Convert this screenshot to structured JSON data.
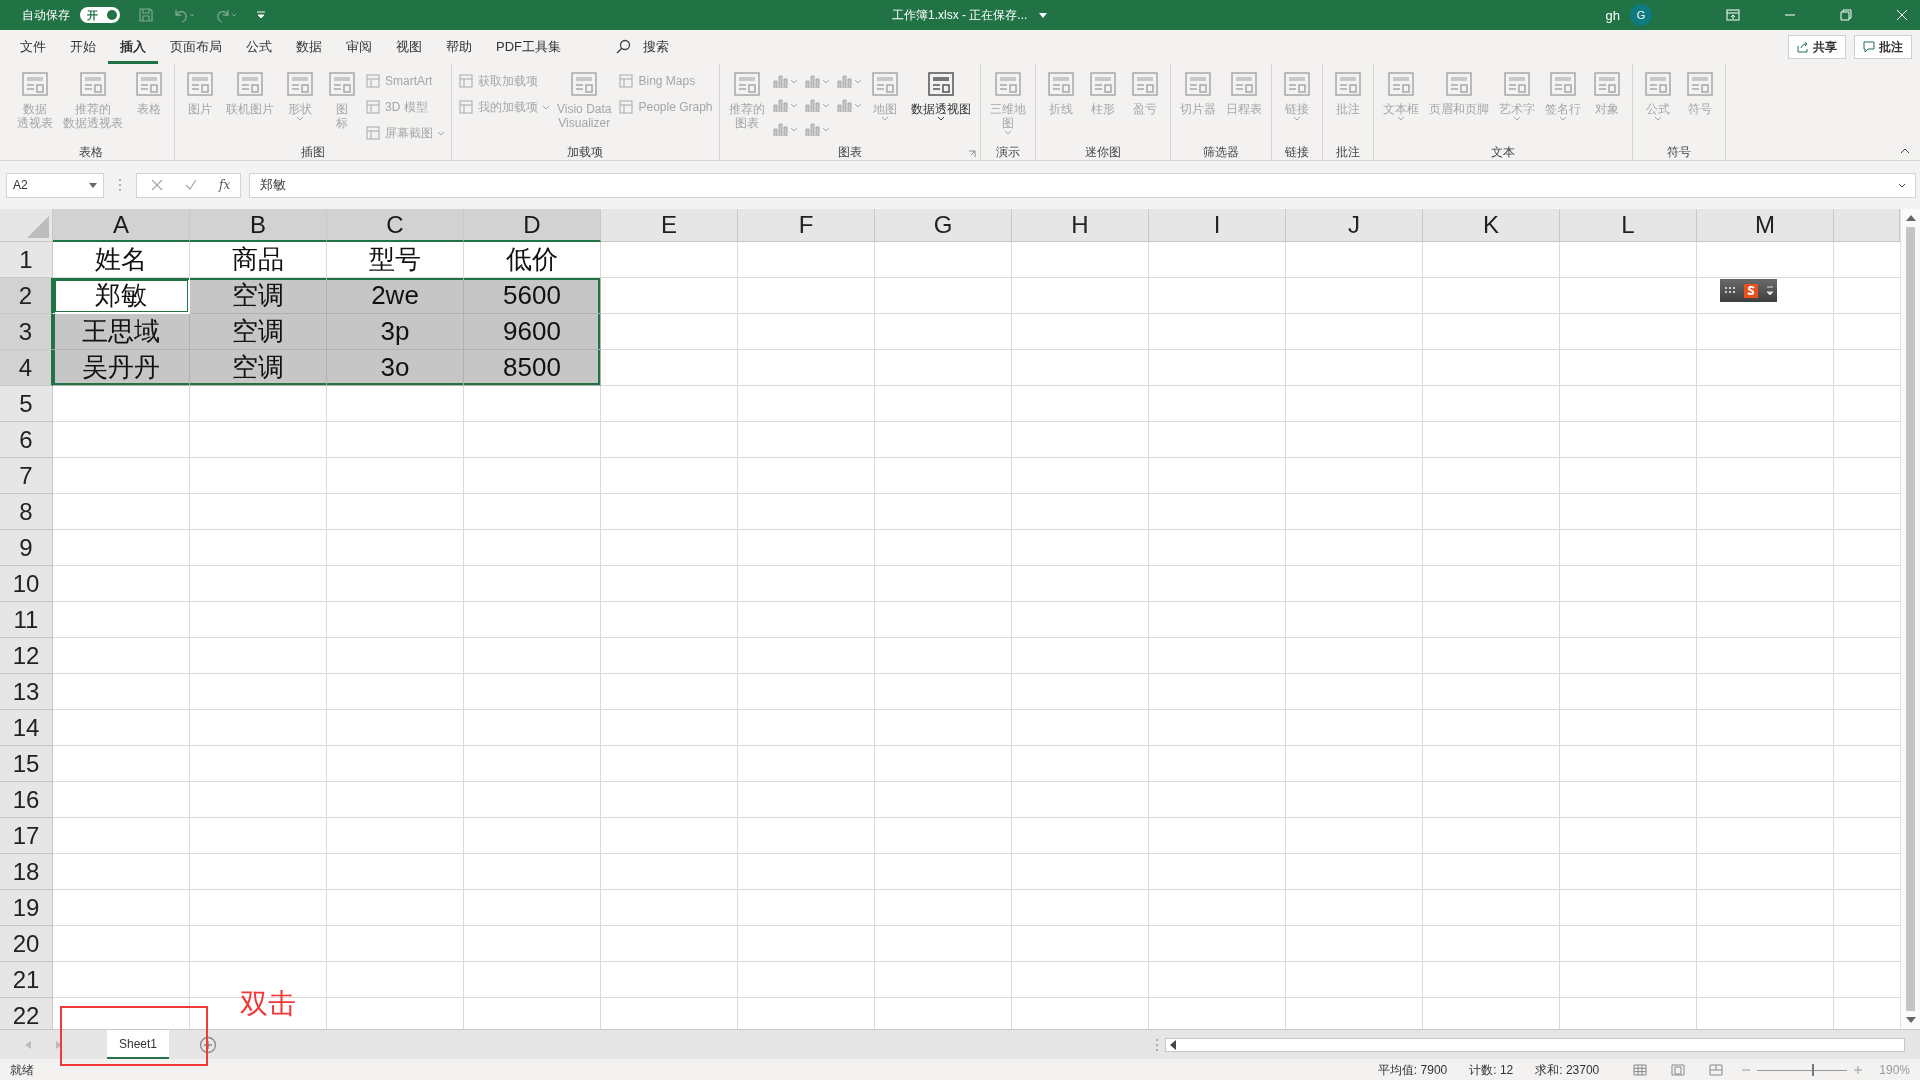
{
  "title_bar": {
    "autosave_label": "自动保存",
    "autosave": {
      "label": "开",
      "on": true
    },
    "document_title": "工作簿1.xlsx  -  正在保存...",
    "user": "gh",
    "avatar": "G"
  },
  "menu_tabs": [
    {
      "label": "文件",
      "selected": false
    },
    {
      "label": "开始",
      "selected": false
    },
    {
      "label": "插入",
      "selected": true
    },
    {
      "label": "页面布局",
      "selected": false
    },
    {
      "label": "公式",
      "selected": false
    },
    {
      "label": "数据",
      "selected": false
    },
    {
      "label": "审阅",
      "selected": false
    },
    {
      "label": "视图",
      "selected": false
    },
    {
      "label": "帮助",
      "selected": false
    },
    {
      "label": "PDF工具集",
      "selected": false
    }
  ],
  "search": {
    "label": "搜索"
  },
  "actions": [
    {
      "kind": "share",
      "label": "共享"
    },
    {
      "kind": "comment",
      "label": "批注"
    }
  ],
  "ribbon": [
    {
      "label": "表格",
      "launcher": false,
      "items": [
        {
          "kind": "large",
          "lines": [
            "数据",
            "透视表"
          ],
          "disabled": true,
          "dropdown": false
        },
        {
          "kind": "large",
          "lines": [
            "推荐的",
            "数据透视表"
          ],
          "disabled": true,
          "dropdown": false
        },
        {
          "kind": "large",
          "lines": [
            "表格"
          ],
          "disabled": true,
          "dropdown": false
        }
      ]
    },
    {
      "label": "插图",
      "launcher": false,
      "items": [
        {
          "kind": "large",
          "lines": [
            "图片"
          ],
          "disabled": true,
          "dropdown": false
        },
        {
          "kind": "large",
          "lines": [
            "联机图片"
          ],
          "disabled": true,
          "dropdown": false
        },
        {
          "kind": "large",
          "lines": [
            "形状"
          ],
          "disabled": true,
          "dropdown": true
        },
        {
          "kind": "large",
          "lines": [
            "图",
            "标"
          ],
          "disabled": true,
          "dropdown": false
        },
        {
          "kind": "stack",
          "items": [
            {
              "label": "SmartArt",
              "disabled": true,
              "dropdown": false
            },
            {
              "label": "3D 模型",
              "disabled": true,
              "dropdown": false
            },
            {
              "label": "屏幕截图",
              "disabled": true,
              "dropdown": true
            }
          ]
        }
      ]
    },
    {
      "label": "加载项",
      "launcher": false,
      "items": [
        {
          "kind": "stack",
          "items": [
            {
              "label": "获取加载项",
              "disabled": true,
              "dropdown": false
            },
            {
              "label": "我的加载项",
              "disabled": true,
              "dropdown": true
            }
          ]
        },
        {
          "kind": "large",
          "lines": [
            "Visio Data",
            "Visualizer"
          ],
          "disabled": true,
          "dropdown": false
        },
        {
          "kind": "stack",
          "items": [
            {
              "label": "Bing Maps",
              "disabled": true,
              "dropdown": false
            },
            {
              "label": "People Graph",
              "disabled": true,
              "dropdown": false
            }
          ]
        }
      ]
    },
    {
      "label": "图表",
      "launcher": true,
      "items": [
        {
          "kind": "large",
          "lines": [
            "推荐的",
            "图表"
          ],
          "disabled": true,
          "dropdown": false
        },
        {
          "kind": "icongrid",
          "items": [
            {
              "disabled": true,
              "dropdown": true
            },
            {
              "disabled": true,
              "dropdown": true
            },
            {
              "disabled": true,
              "dropdown": true
            },
            {
              "disabled": true,
              "dropdown": true
            },
            {
              "disabled": true,
              "dropdown": true
            },
            {
              "disabled": true,
              "dropdown": true
            },
            {
              "disabled": true,
              "dropdown": true
            },
            {
              "disabled": true,
              "dropdown": true
            }
          ]
        },
        {
          "kind": "large",
          "lines": [
            "地图"
          ],
          "disabled": true,
          "dropdown": true
        },
        {
          "kind": "large",
          "lines": [
            "数据透视图"
          ],
          "disabled": false,
          "dropdown": true
        }
      ]
    },
    {
      "label": "演示",
      "launcher": false,
      "items": [
        {
          "kind": "large",
          "lines": [
            "三维地",
            "图"
          ],
          "disabled": true,
          "dropdown": true
        }
      ]
    },
    {
      "label": "迷你图",
      "launcher": false,
      "items": [
        {
          "kind": "large",
          "lines": [
            "折线"
          ],
          "disabled": true,
          "dropdown": false
        },
        {
          "kind": "large",
          "lines": [
            "柱形"
          ],
          "disabled": true,
          "dropdown": false
        },
        {
          "kind": "large",
          "lines": [
            "盈亏"
          ],
          "disabled": true,
          "dropdown": false
        }
      ]
    },
    {
      "label": "筛选器",
      "launcher": false,
      "items": [
        {
          "kind": "large",
          "lines": [
            "切片器"
          ],
          "disabled": true,
          "dropdown": false
        },
        {
          "kind": "large",
          "lines": [
            "日程表"
          ],
          "disabled": true,
          "dropdown": false
        }
      ]
    },
    {
      "label": "链接",
      "launcher": false,
      "items": [
        {
          "kind": "large",
          "lines": [
            "链接"
          ],
          "disabled": true,
          "dropdown": true
        }
      ]
    },
    {
      "label": "批注",
      "launcher": false,
      "items": [
        {
          "kind": "large",
          "lines": [
            "批注"
          ],
          "disabled": true,
          "dropdown": false
        }
      ]
    },
    {
      "label": "文本",
      "launcher": false,
      "items": [
        {
          "kind": "large",
          "lines": [
            "文本框"
          ],
          "disabled": true,
          "dropdown": true
        },
        {
          "kind": "large",
          "lines": [
            "页眉和页脚"
          ],
          "disabled": true,
          "dropdown": false
        },
        {
          "kind": "large",
          "lines": [
            "艺术字"
          ],
          "disabled": true,
          "dropdown": true
        },
        {
          "kind": "large",
          "lines": [
            "签名行"
          ],
          "disabled": true,
          "dropdown": true
        },
        {
          "kind": "large",
          "lines": [
            "对象"
          ],
          "disabled": true,
          "dropdown": false
        }
      ]
    },
    {
      "label": "符号",
      "launcher": false,
      "items": [
        {
          "kind": "large",
          "lines": [
            "公式"
          ],
          "disabled": true,
          "dropdown": true
        },
        {
          "kind": "large",
          "lines": [
            "符号"
          ],
          "disabled": true,
          "dropdown": false
        }
      ]
    }
  ],
  "formula_bar": {
    "name_box": "A2",
    "function_label": "fx",
    "value": "郑敏"
  },
  "sheet": {
    "columns": [
      "A",
      "B",
      "C",
      "D",
      "E",
      "F",
      "G",
      "H",
      "I",
      "J",
      "K",
      "L",
      "M"
    ],
    "rows": [
      {
        "number": "1",
        "cells": [
          {
            "text": "姓名",
            "selected": false,
            "active": false
          },
          {
            "text": "商品",
            "selected": false,
            "active": false
          },
          {
            "text": "型号",
            "selected": false,
            "active": false
          },
          {
            "text": "低价",
            "selected": false,
            "active": false
          }
        ]
      },
      {
        "number": "2",
        "cells": [
          {
            "text": "郑敏",
            "selected": true,
            "active": true
          },
          {
            "text": "空调",
            "selected": true,
            "active": false
          },
          {
            "text": "2we",
            "selected": true,
            "active": false
          },
          {
            "text": "5600",
            "selected": true,
            "active": false
          }
        ]
      },
      {
        "number": "3",
        "cells": [
          {
            "text": "王思域",
            "selected": true,
            "active": false
          },
          {
            "text": "空调",
            "selected": true,
            "active": false
          },
          {
            "text": "3p",
            "selected": true,
            "active": false
          },
          {
            "text": "9600",
            "selected": true,
            "active": false
          }
        ]
      },
      {
        "number": "4",
        "cells": [
          {
            "text": "吴丹丹",
            "selected": true,
            "active": false
          },
          {
            "text": "空调",
            "selected": true,
            "active": false
          },
          {
            "text": "3o",
            "selected": true,
            "active": false
          },
          {
            "text": "8500",
            "selected": true,
            "active": false
          }
        ]
      },
      {
        "number": "5"
      },
      {
        "number": "6"
      },
      {
        "number": "7"
      },
      {
        "number": "8"
      },
      {
        "number": "9"
      },
      {
        "number": "10"
      },
      {
        "number": "11"
      },
      {
        "number": "12"
      },
      {
        "number": "13"
      },
      {
        "number": "14"
      },
      {
        "number": "15"
      },
      {
        "number": "16"
      },
      {
        "number": "17"
      },
      {
        "number": "18"
      },
      {
        "number": "19"
      },
      {
        "number": "20"
      },
      {
        "number": "21"
      },
      {
        "number": "22"
      }
    ]
  },
  "annotation": {
    "text": "双击"
  },
  "sheet_tabs": [
    {
      "label": "Sheet1",
      "selected": true
    }
  ],
  "status_bar": {
    "status": "就绪",
    "stats": [
      "平均值: 7900",
      "计数: 12",
      "求和: 23700"
    ],
    "zoom": {
      "level": 0.62,
      "reading": "190%"
    }
  }
}
